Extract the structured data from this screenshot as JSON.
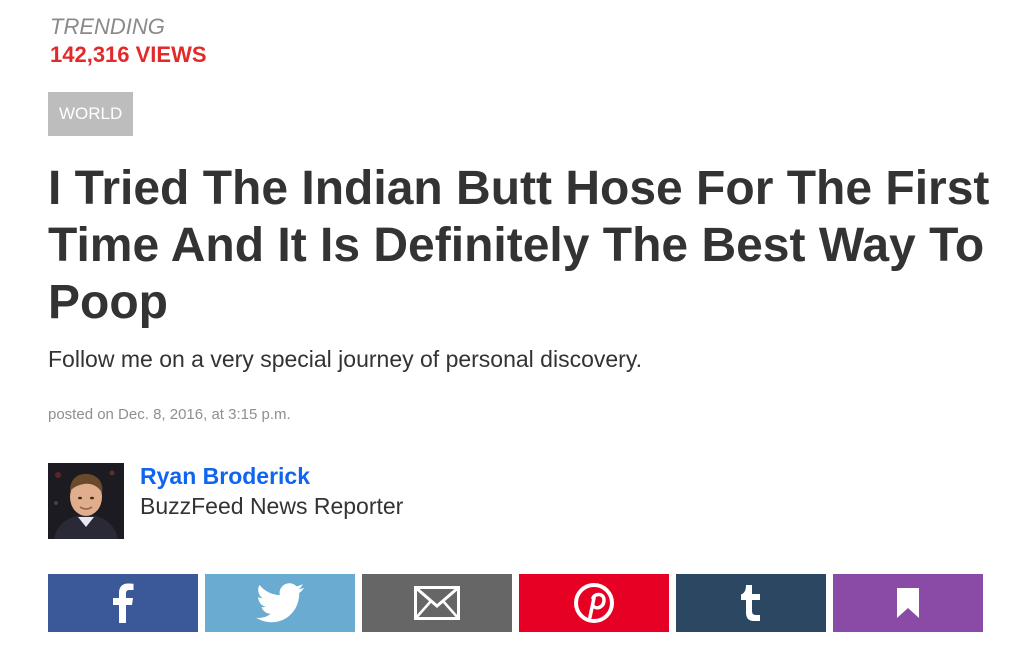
{
  "trending": {
    "label": "TRENDING",
    "views": "142,316 VIEWS",
    "views_color": "#e32a2a"
  },
  "article": {
    "category": "WORLD",
    "headline": "I Tried The Indian Butt Hose For The First Time And It Is Definitely The Best Way To Poop",
    "dek": "Follow me on a very special journey of personal discovery.",
    "posted": "posted on Dec. 8, 2016, at 3:15 p.m."
  },
  "author": {
    "name": "Ryan Broderick",
    "title": "BuzzFeed News Reporter",
    "name_color": "#0f65ef"
  },
  "share": [
    {
      "network": "facebook",
      "icon": "facebook-icon",
      "color": "#3b5998"
    },
    {
      "network": "twitter",
      "icon": "twitter-icon",
      "color": "#6aabd2"
    },
    {
      "network": "email",
      "icon": "email-icon",
      "color": "#666666"
    },
    {
      "network": "pinterest",
      "icon": "pinterest-icon",
      "color": "#e60023"
    },
    {
      "network": "tumblr",
      "icon": "tumblr-icon",
      "color": "#2c4762"
    },
    {
      "network": "bookmark",
      "icon": "bookmark-icon",
      "color": "#8a4ba6"
    }
  ]
}
